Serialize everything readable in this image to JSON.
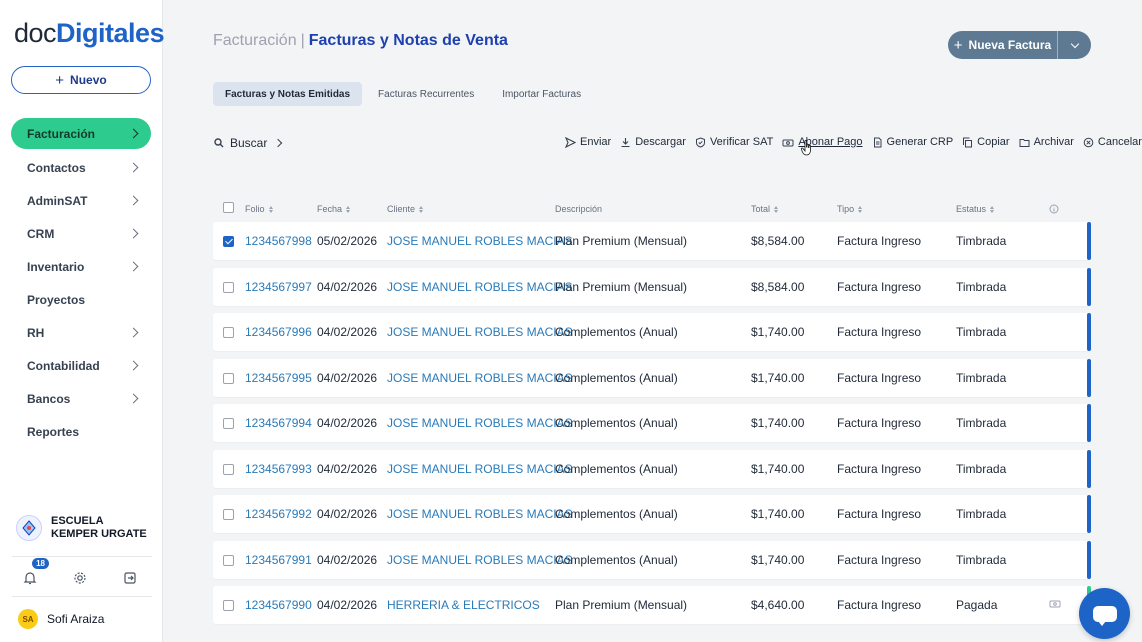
{
  "brand": {
    "logo_left": "doc",
    "logo_right": "Digitales"
  },
  "sidebar": {
    "new_label": "Nuevo",
    "items": [
      {
        "label": "Facturación",
        "active": true,
        "has_chevron": true
      },
      {
        "label": "Contactos",
        "has_chevron": true
      },
      {
        "label": "AdminSAT",
        "has_chevron": true
      },
      {
        "label": "CRM",
        "has_chevron": true
      },
      {
        "label": "Inventario",
        "has_chevron": true
      },
      {
        "label": "Proyectos",
        "has_chevron": false
      },
      {
        "label": "RH",
        "has_chevron": true
      },
      {
        "label": "Contabilidad",
        "has_chevron": true
      },
      {
        "label": "Bancos",
        "has_chevron": true
      },
      {
        "label": "Reportes",
        "has_chevron": false
      }
    ],
    "company": {
      "name": "ESCUELA KEMPER URGATE"
    },
    "notifications_count": "18",
    "user": {
      "initials": "SA",
      "name": "Sofi Araiza"
    }
  },
  "header": {
    "breadcrumb_parent": "Facturación",
    "breadcrumb_separator": "|",
    "breadcrumb_current": "Facturas y Notas de Venta",
    "new_invoice_label": "Nueva Factura"
  },
  "tabs": [
    {
      "label": "Facturas y Notas Emitidas",
      "active": true
    },
    {
      "label": "Facturas Recurrentes"
    },
    {
      "label": "Importar Facturas"
    }
  ],
  "toolbar": {
    "search_label": "Buscar",
    "actions": [
      {
        "label": "Enviar",
        "icon": "send-icon"
      },
      {
        "label": "Descargar",
        "icon": "download-icon"
      },
      {
        "label": "Verificar SAT",
        "icon": "shield-check-icon"
      },
      {
        "label": "Abonar Pago",
        "icon": "cash-icon",
        "hover": true
      },
      {
        "label": "Generar CRP",
        "icon": "document-icon"
      },
      {
        "label": "Copiar",
        "icon": "copy-icon"
      },
      {
        "label": "Archivar",
        "icon": "folder-icon"
      },
      {
        "label": "Cancelar",
        "icon": "cancel-circle-icon"
      }
    ]
  },
  "table": {
    "columns": {
      "folio": "Folio",
      "fecha": "Fecha",
      "cliente": "Cliente",
      "descripcion": "Descripción",
      "total": "Total",
      "tipo": "Tipo",
      "estatus": "Estatus"
    },
    "rows": [
      {
        "checked": true,
        "folio": "1234567998",
        "fecha": "05/02/2026",
        "cliente": "JOSE MANUEL ROBLES MACIAS",
        "descripcion": "Plan Premium (Mensual)",
        "total": "$8,584.00",
        "tipo": "Factura Ingreso",
        "estatus": "Timbrada",
        "stripe": "#1e63c6"
      },
      {
        "checked": false,
        "folio": "1234567997",
        "fecha": "04/02/2026",
        "cliente": "JOSE MANUEL ROBLES MACIAS",
        "descripcion": "Plan Premium (Mensual)",
        "total": "$8,584.00",
        "tipo": "Factura Ingreso",
        "estatus": "Timbrada",
        "stripe": "#1e63c6"
      },
      {
        "checked": false,
        "folio": "1234567996",
        "fecha": "04/02/2026",
        "cliente": "JOSE MANUEL ROBLES MACIAS",
        "descripcion": "Complementos (Anual)",
        "total": "$1,740.00",
        "tipo": "Factura Ingreso",
        "estatus": "Timbrada",
        "stripe": "#1e63c6"
      },
      {
        "checked": false,
        "folio": "1234567995",
        "fecha": "04/02/2026",
        "cliente": "JOSE MANUEL ROBLES MACIAS",
        "descripcion": "Complementos (Anual)",
        "total": "$1,740.00",
        "tipo": "Factura Ingreso",
        "estatus": "Timbrada",
        "stripe": "#1e63c6"
      },
      {
        "checked": false,
        "folio": "1234567994",
        "fecha": "04/02/2026",
        "cliente": "JOSE MANUEL ROBLES MACIAS",
        "descripcion": "Complementos (Anual)",
        "total": "$1,740.00",
        "tipo": "Factura Ingreso",
        "estatus": "Timbrada",
        "stripe": "#1e63c6"
      },
      {
        "checked": false,
        "folio": "1234567993",
        "fecha": "04/02/2026",
        "cliente": "JOSE MANUEL ROBLES MACIAS",
        "descripcion": "Complementos (Anual)",
        "total": "$1,740.00",
        "tipo": "Factura Ingreso",
        "estatus": "Timbrada",
        "stripe": "#1e63c6"
      },
      {
        "checked": false,
        "folio": "1234567992",
        "fecha": "04/02/2026",
        "cliente": "JOSE MANUEL ROBLES MACIAS",
        "descripcion": "Complementos (Anual)",
        "total": "$1,740.00",
        "tipo": "Factura Ingreso",
        "estatus": "Timbrada",
        "stripe": "#1e63c6"
      },
      {
        "checked": false,
        "folio": "1234567991",
        "fecha": "04/02/2026",
        "cliente": "JOSE MANUEL ROBLES MACIAS",
        "descripcion": "Complementos (Anual)",
        "total": "$1,740.00",
        "tipo": "Factura Ingreso",
        "estatus": "Timbrada",
        "stripe": "#1e63c6"
      },
      {
        "checked": false,
        "folio": "1234567990",
        "fecha": "04/02/2026",
        "cliente": "HERRERIA & ELECTRICOS",
        "descripcion": "Plan Premium (Mensual)",
        "total": "$4,640.00",
        "tipo": "Factura Ingreso",
        "estatus": "Pagada",
        "stripe": "#2ecb8e",
        "payment_icon": true
      }
    ]
  },
  "colors": {
    "accent": "#1e63c6",
    "active_nav": "#2ecb8e",
    "link": "#2a7ab8",
    "status_timbrada": "#1e63c6",
    "status_pagada": "#2ecb8e"
  }
}
